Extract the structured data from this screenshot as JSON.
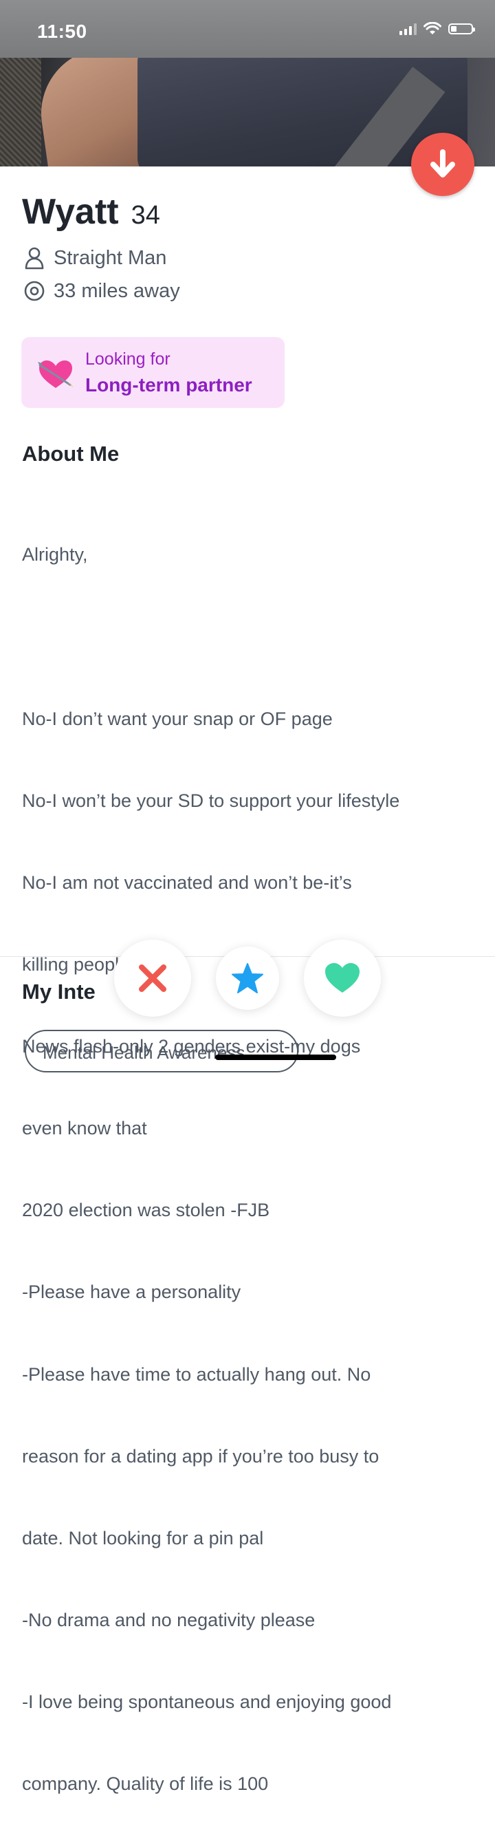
{
  "status_bar": {
    "time": "11:50"
  },
  "profile": {
    "name": "Wyatt",
    "age": "34",
    "orientation": "Straight Man",
    "distance": "33 miles away"
  },
  "looking_for": {
    "label": "Looking for",
    "value": "Long-term partner"
  },
  "about": {
    "title": "About Me",
    "lines": [
      "Alrighty,",
      "",
      "No-I don’t want your snap or OF page",
      "No-I won’t be your SD to support your lifestyle",
      "No-I am not vaccinated and won’t be-it’s",
      "killing people",
      "News flash-only 2 genders exist-my dogs",
      "even know that",
      "2020 election was stolen -FJB",
      "-Please have a personality",
      "-Please have time to actually hang out. No",
      "reason for a dating app if you’re too busy to",
      "date. Not looking for a pin pal",
      "-No drama and no negativity please",
      "-I love being spontaneous and enjoying good",
      "company. Quality of life is 100"
    ]
  },
  "interests": {
    "title": "My Inte",
    "chips": [
      "Mental Health Awareness"
    ]
  },
  "colors": {
    "nope": "#f0584f",
    "super_like": "#1fa1f2",
    "like": "#3ed6a5",
    "looking_for_bg": "#fae3fa",
    "looking_for_text": "#8d1fc1"
  },
  "icons": {
    "collapse": "arrow-down-icon",
    "orientation": "person-icon",
    "distance": "location-pin-icon",
    "looking_for": "heart-arrow-icon",
    "nope": "x-icon",
    "super_like": "star-icon",
    "like": "heart-icon"
  }
}
